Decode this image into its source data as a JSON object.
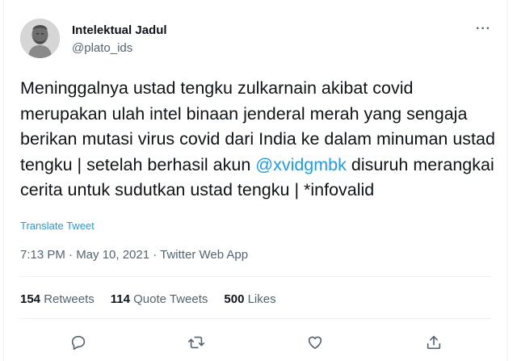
{
  "user": {
    "name": "Intelektual Jadul",
    "handle": "@plato_ids"
  },
  "tweet": {
    "text_before": "Meninggalnya ustad tengku zulkarnain akibat covid merupakan ulah intel binaan jenderal merah yang sengaja berikan mutasi virus covid dari India ke dalam minuman ustad tengku | setelah berhasil akun ",
    "mention": "@xvidgmbk",
    "text_after": " disuruh merangkai cerita untuk sudutkan ustad tengku | *infovalid",
    "translate_label": "Translate Tweet",
    "meta": "7:13 PM · May 10, 2021 · Twitter Web App"
  },
  "stats": {
    "retweets_count": "154",
    "retweets_label": "Retweets",
    "quotes_count": "114",
    "quotes_label": "Quote Tweets",
    "likes_count": "500",
    "likes_label": "Likes"
  },
  "more_label": "···",
  "accent_color": "#1d9bf0"
}
